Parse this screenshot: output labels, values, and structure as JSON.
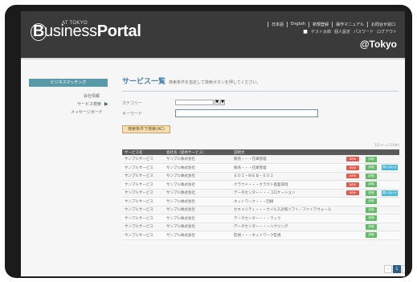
{
  "header": {
    "logo_prefix": "AT TOKYO",
    "logo_b": "B",
    "logo_business": "usiness",
    "logo_portal": "Portal",
    "topnav": [
      "日本語",
      "English",
      "新規登録",
      "操作マニュアル",
      "お問合せ窓口"
    ],
    "subnav": [
      "ゲスト太郎",
      "個人設定",
      "パスワード",
      "ログアウト"
    ],
    "brand": "@Tokyo"
  },
  "sidebar": {
    "active": "ビジネスマッチング",
    "items": [
      "会社情報",
      "サービス検索",
      "メッセージボード"
    ]
  },
  "main": {
    "title": "サービス一覧",
    "title_note": "検索条件を指定して検索ボタンを押してください。",
    "category_label": "カテゴリー",
    "keyword_label": "キーワード",
    "keyword_value": "",
    "search_label": "検索条件で検索(AC)",
    "pager_note": "1/1ページ(10件)",
    "columns": [
      "サービス名",
      "会社名（提供サービス）",
      "説明文",
      "",
      "",
      ""
    ],
    "rows": [
      {
        "service": "サンプルサービス",
        "company": "サンプル株式会社",
        "desc": "販売・・・在庫管理",
        "tag": "NEW",
        "action": "詳細",
        "extra": ""
      },
      {
        "service": "サンプルサービス",
        "company": "サンプル株式会社",
        "desc": "販売・・・在庫管理",
        "tag": "NEW",
        "action": "詳細",
        "extra": "問い合わせ"
      },
      {
        "service": "サンプルサービス",
        "company": "サンプル株式会社",
        "desc": "ＥＤＩ・ＷＥＢ・ＥＤＩ",
        "tag": "NEW",
        "action": "詳細",
        "extra": ""
      },
      {
        "service": "サンプルサービス",
        "company": "サンプル株式会社",
        "desc": "クラウド・・・クラウド基盤環境",
        "tag": "NEW",
        "action": "詳細",
        "extra": ""
      },
      {
        "service": "サンプルサービス",
        "company": "サンプル株式会社",
        "desc": "データセンター・・・コロケーション",
        "tag": "NEW",
        "action": "詳細",
        "extra": "問い合わせ"
      },
      {
        "service": "サンプルサービス",
        "company": "サンプル株式会社",
        "desc": "ネットワーク・・・回線",
        "tag": "",
        "action": "詳細",
        "extra": ""
      },
      {
        "service": "サンプルサービス",
        "company": "サンプル株式会社",
        "desc": "セキュリティ・・・ウイルス対策ソフト／ファイアウォール",
        "tag": "",
        "action": "詳細",
        "extra": ""
      },
      {
        "service": "サンプルサービス",
        "company": "サンプル株式会社",
        "desc": "データセンター・・・ラック",
        "tag": "",
        "action": "詳細",
        "extra": ""
      },
      {
        "service": "サンプルサービス",
        "company": "サンプル株式会社",
        "desc": "データセンター・・・ハウジング",
        "tag": "",
        "action": "詳細",
        "extra": ""
      },
      {
        "service": "サンプルサービス",
        "company": "サンプル株式会社",
        "desc": "監視・・・ネットワーク監視",
        "tag": "",
        "action": "詳細",
        "extra": ""
      }
    ],
    "pages": [
      "‹",
      "1",
      "›"
    ]
  },
  "colors": {
    "header_bg": "#3a3a3a",
    "sidebar_active": "#5a9aa8",
    "title": "#4a7fa6",
    "tag_new": "#e55a4f",
    "btn_green": "#64b96a",
    "btn_blue": "#4cb8d8",
    "page_current": "#2f5d86"
  }
}
